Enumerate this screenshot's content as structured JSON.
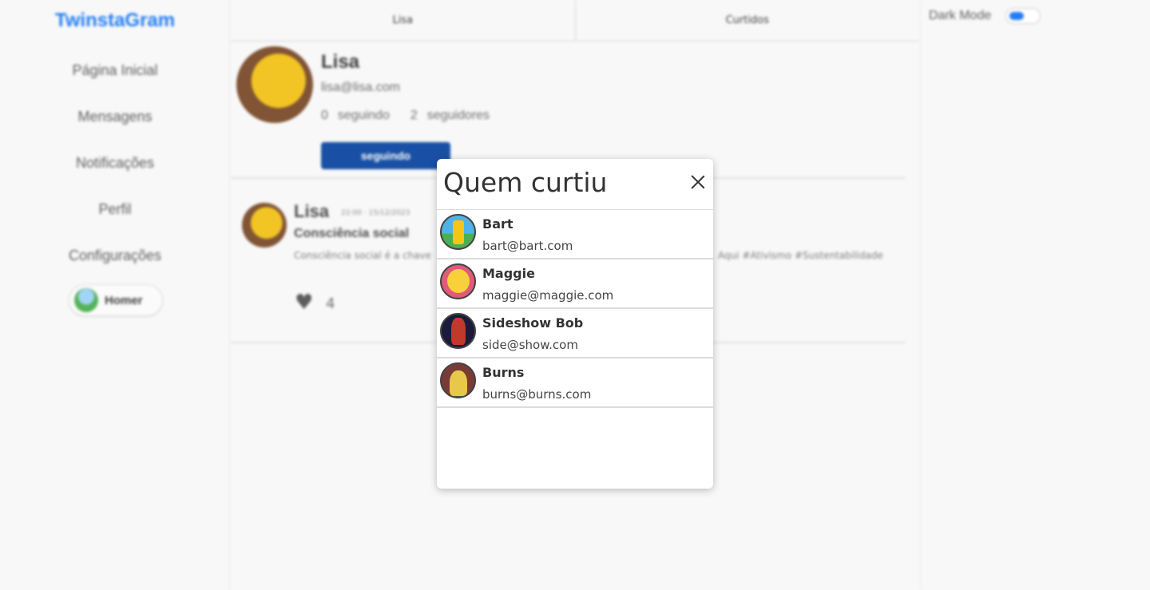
{
  "app": {
    "logo": "TwinstaGram"
  },
  "sidebar": {
    "items": [
      {
        "label": "Página Inicial"
      },
      {
        "label": "Mensagens"
      },
      {
        "label": "Notificações"
      },
      {
        "label": "Perfil"
      },
      {
        "label": "Configurações"
      }
    ],
    "user_chip": {
      "name": "Homer"
    }
  },
  "tabs": [
    {
      "label": "Lisa"
    },
    {
      "label": "Curtidos"
    }
  ],
  "profile": {
    "name": "Lisa",
    "email": "lisa@lisa.com",
    "following_count": "0",
    "following_label": "seguindo",
    "followers_count": "2",
    "followers_label": "seguidores",
    "follow_button": "seguindo"
  },
  "post": {
    "author": "Lisa",
    "time": "22:00 · 15/12/2023",
    "title": "Consciência social",
    "body": "Consciência social é a chave",
    "tags": "Aqui #Ativismo #Sustentabilidade",
    "likes": "4"
  },
  "right": {
    "dark_mode_label": "Dark Mode",
    "dark_mode_on": true
  },
  "modal": {
    "title": "Quem curtiu",
    "users": [
      {
        "name": "Bart",
        "email": "bart@bart.com"
      },
      {
        "name": "Maggie",
        "email": "maggie@maggie.com"
      },
      {
        "name": "Sideshow Bob",
        "email": "side@show.com"
      },
      {
        "name": "Burns",
        "email": "burns@burns.com"
      }
    ]
  },
  "colors": {
    "brand": "#1877f2",
    "button": "#0d47a1"
  }
}
